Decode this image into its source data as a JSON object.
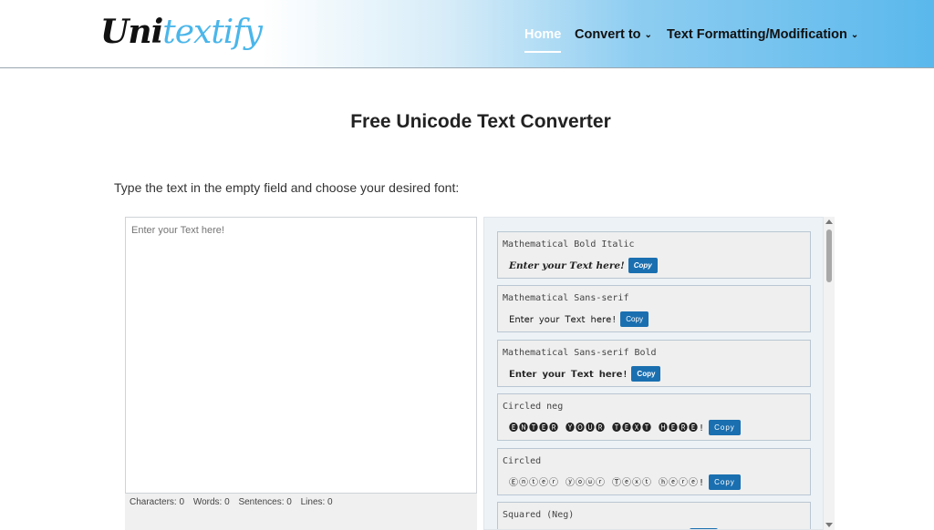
{
  "brand": {
    "part1": "Uni",
    "part2": "textify"
  },
  "nav": {
    "home": "Home",
    "convert_to": "Convert to",
    "text_formatting": "Text Formatting/Modification"
  },
  "page_title": "Free Unicode Text Converter",
  "instruction": "Type the text in the empty field and choose your desired font:",
  "input": {
    "placeholder": "Enter your Text here!"
  },
  "counts": {
    "characters": "Characters: 0",
    "words": "Words: 0",
    "sentences": "Sentences: 0",
    "lines": "Lines: 0"
  },
  "copy_label": "Copy",
  "results": [
    {
      "name": "Mathematical Bold Italic",
      "preview": "𝑬𝒏𝒕𝒆𝒓 𝒚𝒐𝒖𝒓 𝑻𝒆𝒙𝒕 𝒉𝒆𝒓𝒆!"
    },
    {
      "name": "Mathematical Sans-serif",
      "preview": "𝖤𝗇𝗍𝖾𝗋 𝗒𝗈𝗎𝗋 𝖳𝖾𝗑𝗍 𝗁𝖾𝗋𝖾!"
    },
    {
      "name": "Mathematical Sans-serif Bold",
      "preview": "𝗘𝗻𝘁𝗲𝗿 𝘆𝗼𝘂𝗿 𝗧𝗲𝘅𝘁 𝗵𝗲𝗿𝗲!"
    },
    {
      "name": "Circled neg",
      "preview": "🅔🅝🅣🅔🅡 🅨🅞🅤🅡 🅣🅔🅧🅣 🅗🅔🅡🅔!"
    },
    {
      "name": "Circled",
      "preview": "Ⓔⓝⓣⓔⓡ ⓨⓞⓤⓡ Ⓣⓔⓧⓣ ⓗⓔⓡⓔ!"
    },
    {
      "name": "Squared (Neg)",
      "preview": "🅴🅽🆃🅴🆁 🆈🅾🆄🆁 🆃🅴🆇🆃 🅷🅴🆁🅴!"
    }
  ],
  "colors": {
    "accent": "#1a6fb0",
    "header_gradient_end": "#5ab8ec",
    "logo_accent": "#4ab6ea"
  }
}
